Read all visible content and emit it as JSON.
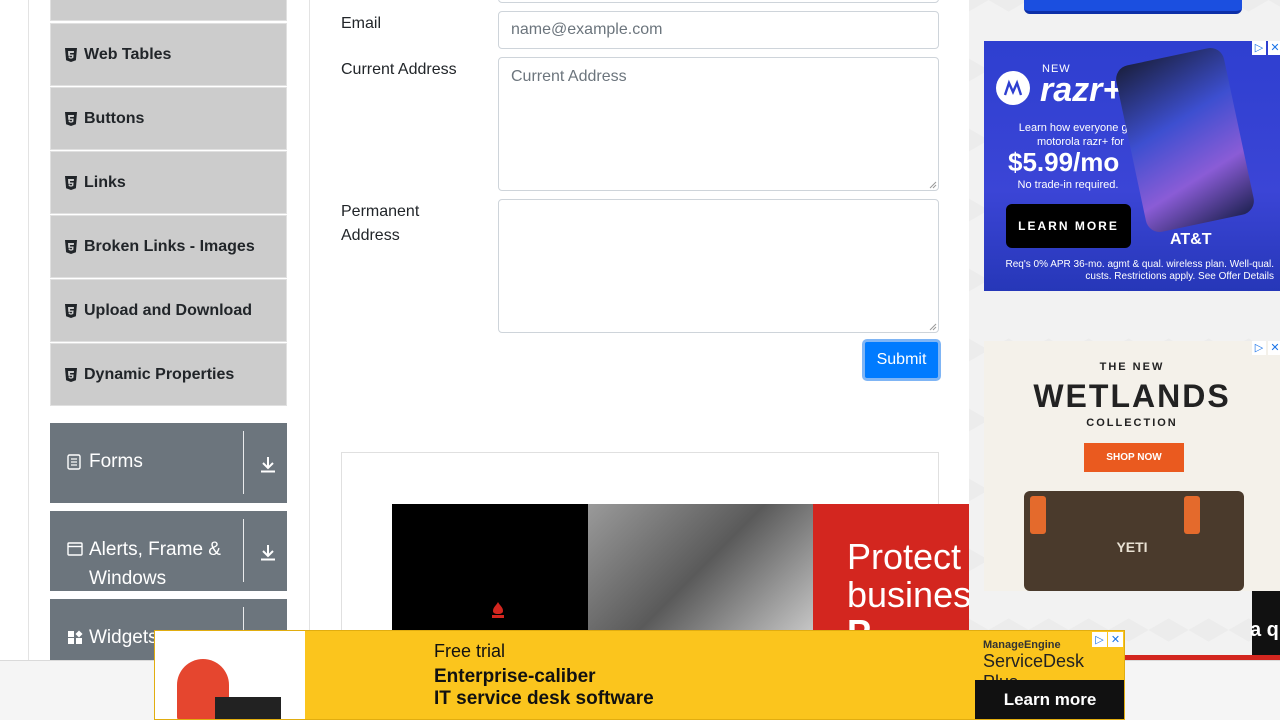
{
  "sidebar": {
    "sub_items": [
      {
        "label": "Web Tables"
      },
      {
        "label": "Buttons"
      },
      {
        "label": "Links"
      },
      {
        "label": "Broken Links - Images"
      },
      {
        "label": "Upload and Download"
      },
      {
        "label": "Dynamic Properties"
      }
    ],
    "groups": [
      {
        "label": "Forms",
        "icon": "form-list-icon"
      },
      {
        "label": "Alerts, Frame &",
        "label2": "Windows",
        "icon": "window-icon"
      },
      {
        "label": "Widgets",
        "icon": "widgets-icon"
      }
    ]
  },
  "form": {
    "email_label": "Email",
    "email_placeholder": "name@example.com",
    "current_address_label": "Current Address",
    "current_address_placeholder": "Current Address",
    "permanent_address_label_1": "Permanent",
    "permanent_address_label_2": "Address",
    "submit_label": "Submit"
  },
  "ads": {
    "center_banner": {
      "headline_1": "Protect",
      "headline_2": "business",
      "headline_3": "P"
    },
    "razr": {
      "new": "NEW",
      "name": "razr+",
      "body": "Learn how everyone gets motorola razr+ for",
      "price": "$5.99/mo",
      "no_trade": "No trade-in required.",
      "cta": "LEARN MORE",
      "carrier": "AT&T",
      "fine_print": "Req's 0% APR 36-mo. agmt & qual. wireless plan. Well-qual. custs. Restrictions apply. See Offer Details"
    },
    "yeti": {
      "kicker": "THE NEW",
      "title": "WETLANDS",
      "collection": "COLLECTION",
      "cta": "SHOP NOW",
      "logo": "YETI"
    },
    "right_strip_text": "a q",
    "bottom": {
      "line1": "Free trial",
      "line2": "Enterprise-caliber",
      "line3": "IT service desk software",
      "vendor": "ManageEngine",
      "product": "ServiceDesk Plus",
      "cta": "Learn more"
    }
  },
  "colors": {
    "primary": "#007bff",
    "group_bg": "#6c757d",
    "sub_item_bg": "#cccccc",
    "ad_yellow": "#fbc51d",
    "ad_red": "#d3261f"
  }
}
